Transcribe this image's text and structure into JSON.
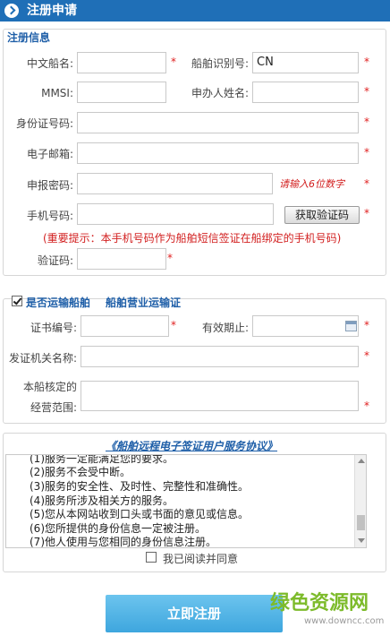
{
  "header": {
    "title": "注册申请"
  },
  "registration": {
    "section_title": "注册信息",
    "ship_name_label": "中文船名:",
    "ship_name_value": "",
    "ship_id_label": "船舶识别号:",
    "ship_id_value": "CN",
    "mmsi_label": "MMSI:",
    "mmsi_value": "",
    "applicant_label": "申办人姓名:",
    "applicant_value": "",
    "id_card_label": "身份证号码:",
    "id_card_value": "",
    "email_label": "电子邮箱:",
    "email_value": "",
    "password_label": "申报密码:",
    "password_value": "",
    "password_hint": "请输入6位数字",
    "phone_label": "手机号码:",
    "phone_value": "",
    "get_code_button": "获取验证码",
    "important_tip": "(重要提示：本手机号码作为船舶短信签证在船绑定的手机号码)",
    "code_label": "验证码:",
    "code_value": "",
    "required_mark": "*"
  },
  "transport": {
    "checkbox_checked": true,
    "section_title": "是否运输船舶",
    "sub_title": "船舶营业运输证",
    "cert_no_label": "证书编号:",
    "cert_no_value": "",
    "valid_until_label": "有效期止:",
    "valid_until_value": "",
    "issuer_label": "发证机关名称:",
    "issuer_value": "",
    "scope_label_line1": "本船核定的",
    "scope_label_line2": "经营范围:",
    "scope_value": "",
    "calendar_icon": "calendar-icon"
  },
  "agreement": {
    "link_text": "《船舶远程电子签证用户服务协议》",
    "lines": [
      "(1)服务一定能满足您的要求。",
      "(2)服务不会受中断。",
      "(3)服务的安全性、及时性、完整性和准确性。",
      "(4)服务所涉及相关方的服务。",
      "(5)您从本网站收到口头或书面的意见或信息。",
      "(6)您所提供的身份信息一定被注册。",
      "(7)他人使用与您相同的身份信息注册。"
    ],
    "scroll_position": 0.88,
    "agree_label": "我已阅读并同意",
    "agree_checked": false
  },
  "actions": {
    "submit_label": "立即注册"
  },
  "watermark": {
    "logo_text": "绿色资源网",
    "url_text": "www.downcc.com"
  },
  "colors": {
    "header_bg": "#1f6fb7",
    "title_blue": "#1f5fa8",
    "required_red": "#e02020",
    "submit_bg": "#46aee2",
    "watermark_green": "#7dbb2b"
  }
}
